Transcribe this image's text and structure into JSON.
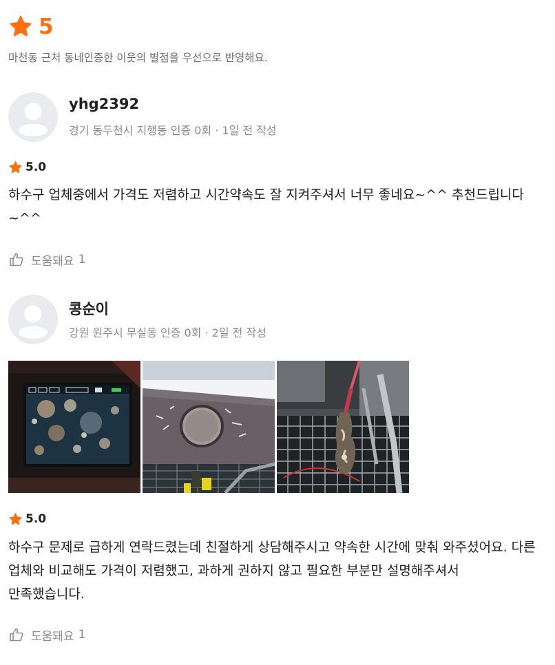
{
  "summary": {
    "rating_icon": "star-icon",
    "rating": "5",
    "note": "마천동 근처 동네인증한 이웃의 별점을 우선으로 반영해요."
  },
  "colors": {
    "accent": "#ff6f0f",
    "text": "#212124",
    "muted": "#868b94"
  },
  "reviews": [
    {
      "avatar_icon": "default-avatar-icon",
      "name": "yhg2392",
      "meta": "경기 동두천시 지행동 인증 0회 · 1일 전 작성",
      "rating_icon": "star-icon",
      "rating": "5.0",
      "text": "하수구 업체중에서 가격도 저렴하고 시간약속도 잘 지켜주셔서 너무 좋네요~^^ 추천드립니다~^^",
      "helpful_icon": "thumbs-up-icon",
      "helpful_label": "도움돼요",
      "helpful_count": "1"
    },
    {
      "avatar_icon": "default-avatar-icon",
      "name": "콩순이",
      "meta": "강원 원주시 무실동 인증 0회 · 2일 전 작성",
      "photos": [
        "pipe-camera-screen-photo",
        "pipe-cut-hole-photo",
        "removed-clog-debris-photo"
      ],
      "rating_icon": "star-icon",
      "rating": "5.0",
      "text": "하수구 문제로 급하게 연락드렸는데 친절하게 상담해주시고 약속한 시간에 맞춰 와주셨어요. 다른 업체와 비교해도 가격이 저렴했고, 과하게 권하지 않고 필요한 부분만 설명해주셔서 만족했습니다.",
      "helpful_icon": "thumbs-up-icon",
      "helpful_label": "도움돼요",
      "helpful_count": "1"
    }
  ]
}
